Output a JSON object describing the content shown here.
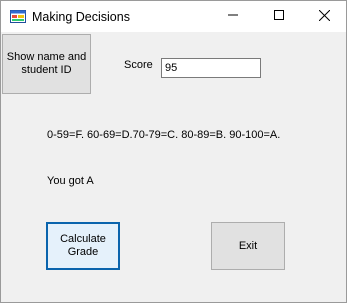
{
  "window": {
    "title": "Making Decisions"
  },
  "form": {
    "show_button_label": "Show name and student ID",
    "score_label": "Score",
    "score_value": "95",
    "grade_scale_text": "0-59=F. 60-69=D.70-79=C. 80-89=B. 90-100=A.",
    "result_text": "You got A",
    "calculate_button_label": "Calculate Grade",
    "exit_button_label": "Exit"
  },
  "icons": {
    "app": "app-form-icon",
    "minimize": "minimize-icon",
    "maximize": "maximize-icon",
    "close": "close-icon"
  },
  "colors": {
    "focus_border": "#0a64ad",
    "window_bg": "#f0f0f0"
  }
}
